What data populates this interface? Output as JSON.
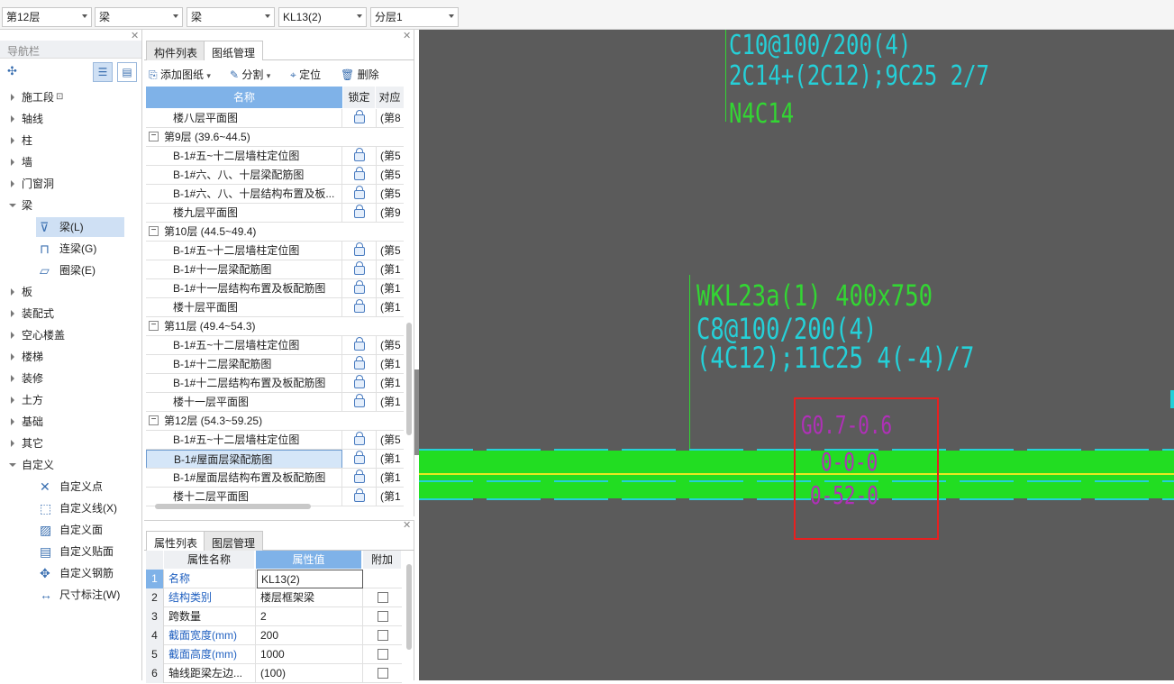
{
  "toolbar": {
    "floor_select": "第12层",
    "type_select": "梁",
    "subtype_select": "梁",
    "component_select": "KL13(2)",
    "layer_select": "分层1"
  },
  "nav": {
    "title": "导航栏",
    "items": [
      {
        "label": "施工段",
        "state": "collapsed"
      },
      {
        "label": "轴线",
        "state": "collapsed"
      },
      {
        "label": "柱",
        "state": "collapsed"
      },
      {
        "label": "墙",
        "state": "collapsed"
      },
      {
        "label": "门窗洞",
        "state": "collapsed"
      },
      {
        "label": "梁",
        "state": "expanded"
      },
      {
        "label": "板",
        "state": "collapsed"
      },
      {
        "label": "装配式",
        "state": "collapsed"
      },
      {
        "label": "空心楼盖",
        "state": "collapsed"
      },
      {
        "label": "楼梯",
        "state": "collapsed"
      },
      {
        "label": "装修",
        "state": "collapsed"
      },
      {
        "label": "土方",
        "state": "collapsed"
      },
      {
        "label": "基础",
        "state": "collapsed"
      },
      {
        "label": "其它",
        "state": "collapsed"
      },
      {
        "label": "自定义",
        "state": "expanded"
      }
    ],
    "beam_children": [
      {
        "label": "梁(L)",
        "icon": "beam-icon",
        "selected": true
      },
      {
        "label": "连梁(G)",
        "icon": "coupling-beam-icon",
        "selected": false
      },
      {
        "label": "圈梁(E)",
        "icon": "ring-beam-icon",
        "selected": false
      }
    ],
    "custom_children": [
      {
        "label": "自定义点",
        "icon": "custom-point-icon"
      },
      {
        "label": "自定义线(X)",
        "icon": "custom-line-icon"
      },
      {
        "label": "自定义面",
        "icon": "custom-area-icon"
      },
      {
        "label": "自定义贴面",
        "icon": "custom-facing-icon"
      },
      {
        "label": "自定义钢筋",
        "icon": "custom-rebar-icon"
      },
      {
        "label": "尺寸标注(W)",
        "icon": "dimension-icon"
      }
    ]
  },
  "drawing_panel": {
    "tabs": [
      "构件列表",
      "图纸管理"
    ],
    "active_tab": "图纸管理",
    "actions": {
      "add": "添加图纸",
      "split": "分割",
      "locate": "定位",
      "delete": "删除"
    },
    "columns": [
      "名称",
      "锁定",
      "对应"
    ],
    "rows": [
      {
        "type": "item",
        "name": "楼八层平面图",
        "corr": "(第8"
      },
      {
        "type": "group",
        "name": "第9层 (39.6~44.5)"
      },
      {
        "type": "item",
        "name": "B-1#五~十二层墙柱定位图",
        "corr": "(第5"
      },
      {
        "type": "item",
        "name": "B-1#六、八、十层梁配筋图",
        "corr": "(第5"
      },
      {
        "type": "item",
        "name": "B-1#六、八、十层结构布置及板...",
        "corr": "(第5"
      },
      {
        "type": "item",
        "name": "楼九层平面图",
        "corr": "(第9"
      },
      {
        "type": "group",
        "name": "第10层 (44.5~49.4)"
      },
      {
        "type": "item",
        "name": "B-1#五~十二层墙柱定位图",
        "corr": "(第5"
      },
      {
        "type": "item",
        "name": "B-1#十一层梁配筋图",
        "corr": "(第1"
      },
      {
        "type": "item",
        "name": "B-1#十一层结构布置及板配筋图",
        "corr": "(第1"
      },
      {
        "type": "item",
        "name": "楼十层平面图",
        "corr": "(第1"
      },
      {
        "type": "group",
        "name": "第11层 (49.4~54.3)"
      },
      {
        "type": "item",
        "name": "B-1#五~十二层墙柱定位图",
        "corr": "(第5"
      },
      {
        "type": "item",
        "name": "B-1#十二层梁配筋图",
        "corr": "(第1"
      },
      {
        "type": "item",
        "name": "B-1#十二层结构布置及板配筋图",
        "corr": "(第1"
      },
      {
        "type": "item",
        "name": "楼十一层平面图",
        "corr": "(第1"
      },
      {
        "type": "group",
        "name": "第12层 (54.3~59.25)"
      },
      {
        "type": "item",
        "name": "B-1#五~十二层墙柱定位图",
        "corr": "(第5"
      },
      {
        "type": "item",
        "name": "B-1#屋面层梁配筋图",
        "corr": "(第1",
        "selected": true
      },
      {
        "type": "item",
        "name": "B-1#屋面层结构布置及板配筋图",
        "corr": "(第1"
      },
      {
        "type": "item",
        "name": "楼十二层平面图",
        "corr": "(第1"
      }
    ]
  },
  "property_panel": {
    "tabs": [
      "属性列表",
      "图层管理"
    ],
    "active_tab": "属性列表",
    "columns": [
      "属性名称",
      "属性值",
      "附加"
    ],
    "rows": [
      {
        "idx": "1",
        "name": "名称",
        "value": "KL13(2)",
        "blue": true,
        "check": false
      },
      {
        "idx": "2",
        "name": "结构类别",
        "value": "楼层框架梁",
        "blue": true,
        "check": true
      },
      {
        "idx": "3",
        "name": "跨数量",
        "value": "2",
        "blue": false,
        "check": true
      },
      {
        "idx": "4",
        "name": "截面宽度(mm)",
        "value": "200",
        "blue": true,
        "check": true
      },
      {
        "idx": "5",
        "name": "截面高度(mm)",
        "value": "1000",
        "blue": true,
        "check": true
      },
      {
        "idx": "6",
        "name": "轴线距梁左边...",
        "value": "(100)",
        "blue": false,
        "check": true
      }
    ]
  },
  "canvas": {
    "annotations_top": [
      "C10@100/200(4)",
      "2C14+(2C12);9C25 2/7",
      "N4C14"
    ],
    "beam_label": [
      "WKL23a(1) 400x750",
      "C8@100/200(4)",
      "(4C12);11C25 4(-4)/7"
    ],
    "elevation_marks": [
      "G0.7-0.6",
      "0-0-0",
      "0-52-0"
    ],
    "colors": {
      "background": "#5b5b5b",
      "cyan_text": "#25d0d8",
      "green_text": "#33d633",
      "magenta_text": "#b030b8",
      "beam_fill": "#22dd22",
      "highlight_box": "#e82020"
    }
  }
}
